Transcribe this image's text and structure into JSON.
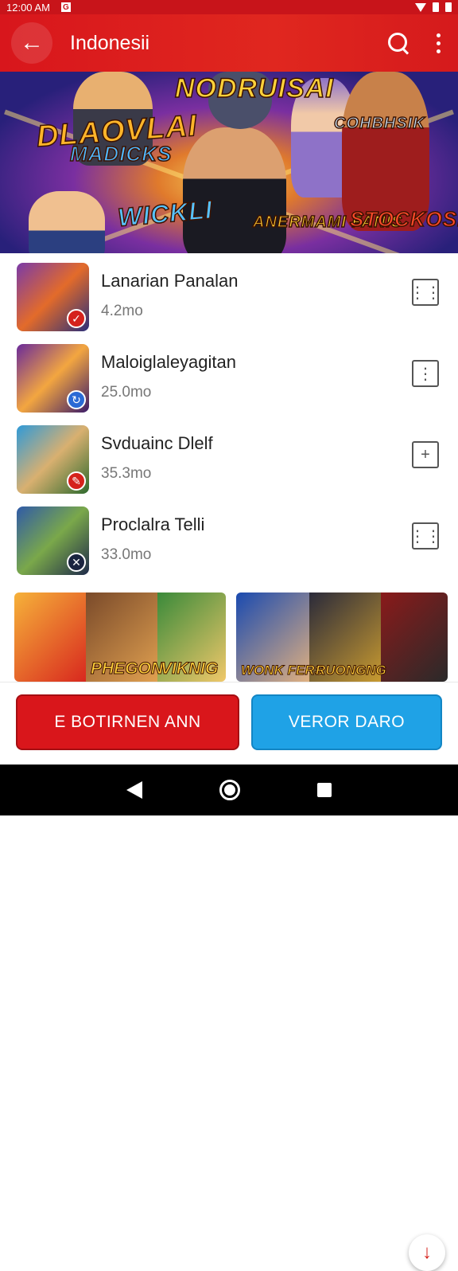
{
  "status_bar": {
    "time": "12:00 AM",
    "notif": "G"
  },
  "app_bar": {
    "title": "Indonesii"
  },
  "banner": {
    "title": "NODRUISAI",
    "left_title": "DLAOVLAI",
    "left_sub": "MADICKS",
    "right_title": "COHBHSIK",
    "wick": "WICKLI",
    "panel": "ANERMAMI FANIS",
    "sto": "STOCKOSN"
  },
  "list": {
    "items": [
      {
        "name": "Lanarian Panalan",
        "size": "4.2mo",
        "dl_icon": "⋮⋮"
      },
      {
        "name": "Maloiglaleyagitan",
        "size": "25.0mo",
        "dl_icon": "⋮"
      },
      {
        "name": "Svduainc Dlelf",
        "size": "35.3mo",
        "dl_icon": "+"
      },
      {
        "name": "Proclalra Telli",
        "size": "33.0mo",
        "dl_icon": "⋮⋮"
      }
    ]
  },
  "gallery": {
    "tile1_caps": [
      "PHEGON",
      "VIKNIG"
    ],
    "tile2_caps": [
      "WONK FERS",
      "RUONGNG"
    ]
  },
  "actions": {
    "primary": "E BOTIRNEN ANN",
    "secondary": "VEROR DARO"
  },
  "colors": {
    "brand_red": "#d9161b",
    "accent_blue": "#1fa2e6"
  }
}
